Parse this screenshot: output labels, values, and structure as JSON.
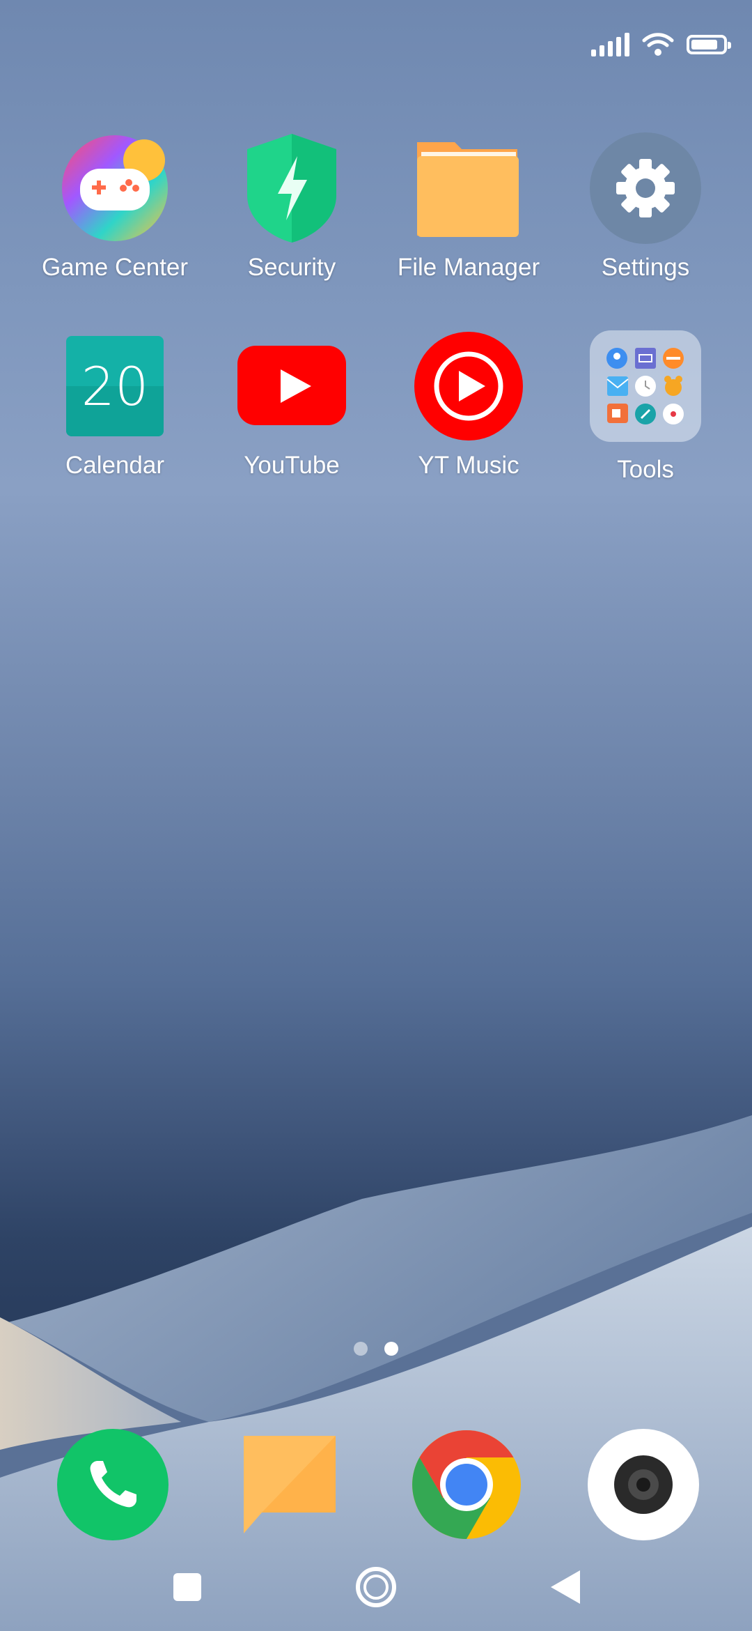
{
  "home_apps": [
    {
      "label": "Game Center",
      "icon": "game-controller-icon"
    },
    {
      "label": "Security",
      "icon": "shield-bolt-icon"
    },
    {
      "label": "File Manager",
      "icon": "folder-icon"
    },
    {
      "label": "Settings",
      "icon": "gear-icon"
    },
    {
      "label": "Calendar",
      "icon": "calendar-icon",
      "day": "20"
    },
    {
      "label": "YouTube",
      "icon": "youtube-icon"
    },
    {
      "label": "YT Music",
      "icon": "yt-music-icon"
    },
    {
      "label": "Tools",
      "icon": "folder-tools-icon"
    }
  ],
  "dock": [
    {
      "icon": "phone-icon"
    },
    {
      "icon": "messages-icon"
    },
    {
      "icon": "chrome-icon"
    },
    {
      "icon": "camera-icon"
    }
  ],
  "page_indicator": {
    "count": 2,
    "active_index": 1
  },
  "status": {
    "battery_level": 0.85
  },
  "colors": {
    "security": "#1fd48a",
    "file_manager": "#ffbe5e",
    "settings_bg": "#6e87a6",
    "calendar": "#14b1a7",
    "youtube_red": "#ff0000",
    "phone_green": "#11c468"
  }
}
